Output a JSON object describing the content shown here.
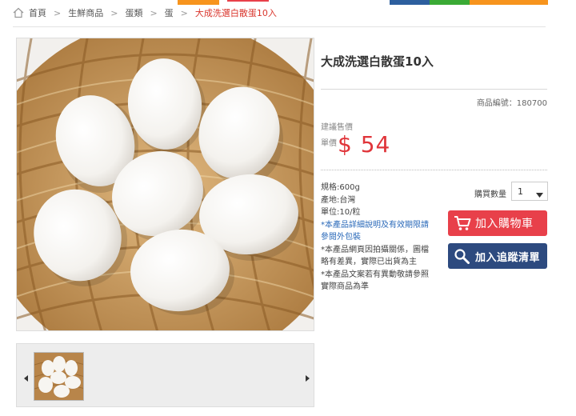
{
  "colors": {
    "accent_red": "#e0353a",
    "cart_button": "#e8404a",
    "track_button": "#2d4a7f",
    "link_blue": "#2a69b9",
    "strip_orange": "#f7941d",
    "strip_blue": "#2d5f9e",
    "strip_green": "#3aaa35"
  },
  "breadcrumb": {
    "items": [
      "首頁",
      "生鮮商品",
      "蛋類",
      "蛋",
      "大成洗選白散蛋10入"
    ],
    "separator": ">"
  },
  "product": {
    "title": "大成洗選白散蛋10入",
    "code_label": "商品編號：180700",
    "price_label": "建議售價",
    "unit_label": "單價",
    "price": "$ 54",
    "specs": {
      "weight": "規格:600g",
      "origin": "產地:台灣",
      "unit": "單位:10/粒",
      "link": "*本產品詳細說明及有效期限請參閱外包裝",
      "note1": "*本產品網頁因拍攝關係，圖檔略有差異，實際已出貨為主",
      "note2": "*本產品文案若有異動敬請參照實際商品為準"
    }
  },
  "purchase": {
    "qty_label": "購買數量",
    "qty_value": "1",
    "add_to_cart": "加入購物車",
    "add_to_tracking": "加入追蹤清單"
  },
  "icons": {
    "home": "home-icon",
    "cart": "cart-icon",
    "search": "magnifier-icon",
    "prev": "triangle-left-icon",
    "next": "triangle-right-icon",
    "dropdown": "chevron-down-icon"
  }
}
